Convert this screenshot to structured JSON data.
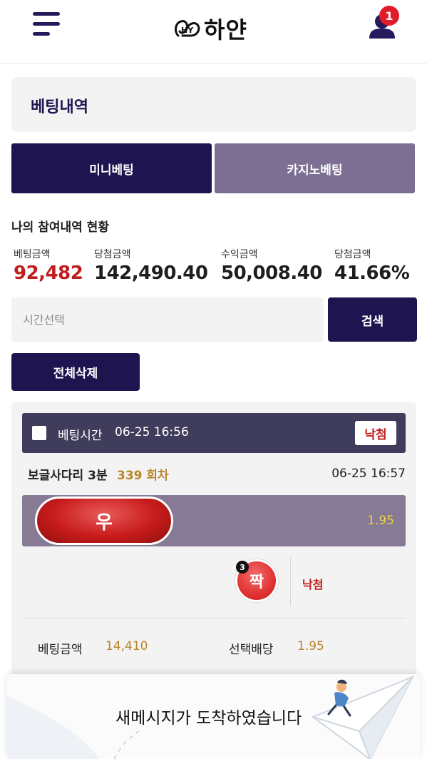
{
  "header": {
    "logo_text": "하얀",
    "logo_mark": "HY",
    "notification_count": "1"
  },
  "page": {
    "title": "베팅내역"
  },
  "tabs": [
    {
      "label": "미니베팅",
      "active": true
    },
    {
      "label": "카지노베팅",
      "active": false
    }
  ],
  "summary": {
    "title": "나의 참여내역 현황",
    "stats": [
      {
        "label": "베팅금액",
        "value": "92,482"
      },
      {
        "label": "당첨금액",
        "value": "142,490.40"
      },
      {
        "label": "수익금액",
        "value": "50,008.40"
      },
      {
        "label": "당첨금액",
        "value": "41.66%"
      }
    ]
  },
  "search": {
    "placeholder": "시간선택",
    "button_label": "검색"
  },
  "actions": {
    "delete_all_label": "전체삭제"
  },
  "bet": {
    "time_label": "베팅시간",
    "time_value": "06-25 16:56",
    "result_badge": "낙첨",
    "game_name": "보글사다리 3분",
    "round": "339 회차",
    "game_time": "06-25 16:57",
    "pick": "우",
    "odds": "1.95",
    "result_ball_number": "3",
    "result_ball_label": "짝",
    "result_text": "낙첨",
    "amount_label": "베팅금액",
    "amount_value": "14,410",
    "odds_label": "선택배당",
    "odds_value": "1.95"
  },
  "toast": {
    "message": "새메시지가 도착하였습니다"
  },
  "colors": {
    "primary": "#1e1450",
    "secondary": "#7c6f93",
    "accent_red": "#c21d1d",
    "gold": "#b8862d"
  }
}
